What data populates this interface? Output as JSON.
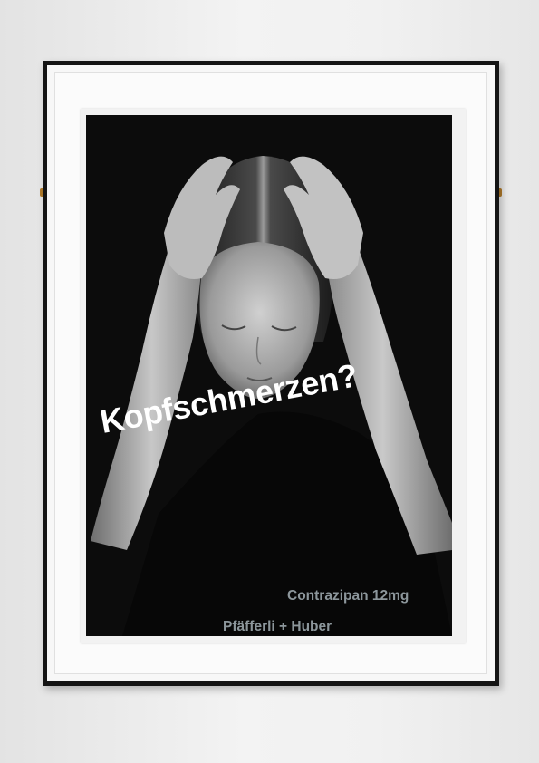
{
  "poster": {
    "headline": "Kopfschmerzen?",
    "product": "Contrazipan 12mg",
    "brand": "Pfäfferli + Huber"
  },
  "colors": {
    "poster_background": "#0c0c0c",
    "headline": "#ffffff",
    "secondary_text": "#8c969b",
    "frame": "#141414"
  }
}
